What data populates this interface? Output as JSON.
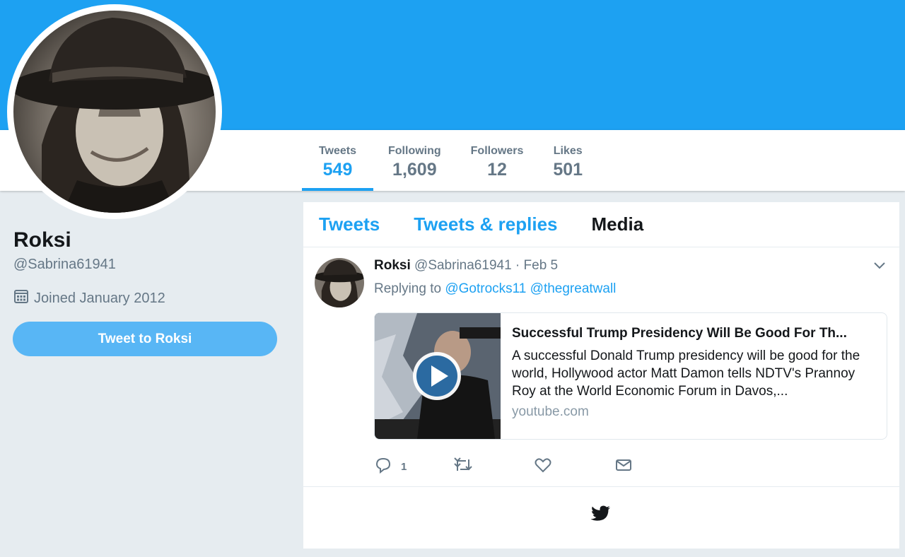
{
  "profile": {
    "name": "Roksi",
    "handle": "@Sabrina61941",
    "joined": "Joined January 2012",
    "tweet_to_label": "Tweet to Roksi"
  },
  "stats": [
    {
      "label": "Tweets",
      "value": "549"
    },
    {
      "label": "Following",
      "value": "1,609"
    },
    {
      "label": "Followers",
      "value": "12"
    },
    {
      "label": "Likes",
      "value": "501"
    }
  ],
  "timeline_tabs": [
    "Tweets",
    "Tweets & replies",
    "Media"
  ],
  "tweet": {
    "name": "Roksi",
    "meta": "@Sabrina61941 · Feb 5",
    "replying_prefix": "Replying to",
    "mentions": [
      "@Gotrocks11",
      "@thegreatwall"
    ],
    "card": {
      "title": "Successful Trump Presidency Will Be Good For Th...",
      "description": "A successful Donald Trump presidency will be good for the world, Hollywood actor Matt Damon tells NDTV's Prannoy Roy at the World Economic Forum in Davos,...",
      "domain": "youtube.com"
    },
    "reply_count": "1"
  },
  "colors": {
    "brand_blue": "#1da1f2",
    "button_blue": "#58b6f5",
    "muted": "#657786",
    "background": "#e6ecf0"
  },
  "icons": [
    "calendar-icon",
    "chevron-down-icon",
    "reply-icon",
    "retweet-icon",
    "like-icon",
    "dm-icon",
    "play-icon",
    "twitter-bird-icon"
  ]
}
